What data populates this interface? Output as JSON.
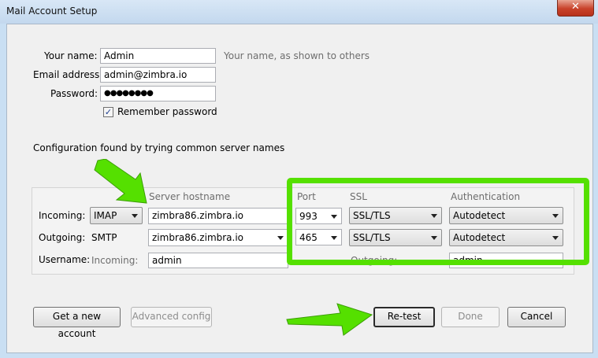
{
  "window": {
    "title": "Mail Account Setup",
    "close_glyph": "✕"
  },
  "form": {
    "name_label": "Your name:",
    "name_value": "Admin",
    "name_hint": "Your name, as shown to others",
    "email_label": "Email address:",
    "email_value": "admin@zimbra.io",
    "password_label": "Password:",
    "password_value": "●●●●●●●●",
    "remember_label": "Remember password",
    "remember_checked": true,
    "status_text": "Configuration found by trying common server names"
  },
  "server": {
    "col_hostname": "Server hostname",
    "col_port": "Port",
    "col_ssl": "SSL",
    "col_auth": "Authentication",
    "incoming_label": "Incoming:",
    "incoming_protocol": "IMAP",
    "incoming_host": "zimbra86.zimbra.io",
    "incoming_port": "993",
    "incoming_ssl": "SSL/TLS",
    "incoming_auth": "Autodetect",
    "outgoing_label": "Outgoing:",
    "outgoing_protocol": "SMTP",
    "outgoing_host": "zimbra86.zimbra.io",
    "outgoing_port": "465",
    "outgoing_ssl": "SSL/TLS",
    "outgoing_auth": "Autodetect",
    "username_label": "Username:",
    "username_incoming_label": "Incoming:",
    "username_incoming_value": "admin",
    "username_outgoing_label": "Outgoing:",
    "username_outgoing_value": "admin"
  },
  "buttons": {
    "get_account": "Get a new account",
    "advanced": "Advanced config",
    "retest": "Re-test",
    "done": "Done",
    "cancel": "Cancel"
  },
  "colors": {
    "annotation_green": "#55e000",
    "close_red": "#c8422a"
  },
  "icons": {
    "arrow": "annotation-arrow-icon",
    "checkbox": "checkmark-icon",
    "close": "close-icon"
  }
}
